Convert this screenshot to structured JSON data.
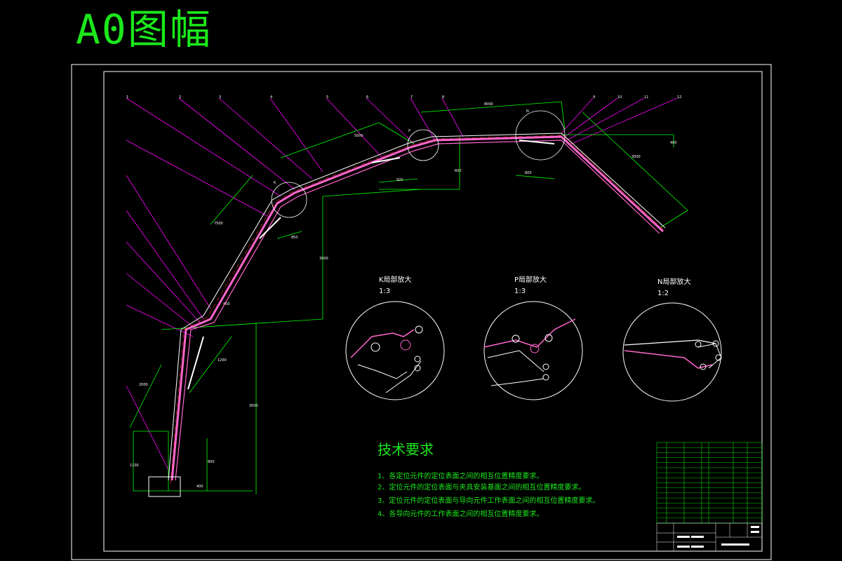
{
  "sheet": {
    "title": "A0图幅"
  },
  "callouts": [
    {
      "mark": "K",
      "caption": "K局部放大",
      "scale": "1:3"
    },
    {
      "mark": "P",
      "caption": "P局部放大",
      "scale": "1:3"
    },
    {
      "mark": "N",
      "caption": "N局部放大",
      "scale": "1:2"
    }
  ],
  "technical_requirements": {
    "heading": "技术要求",
    "items": [
      "1、各定位元件的定位表面之间的相互位置精度要求。",
      "2、定位元件的定位表面与夹具安装基面之间的相互位置精度要求。",
      "3、定位元件的定位表面与导向元件工作表面之间的相互位置精度要求。",
      "4、各导向元件的工作表面之间的相互位置精度要求。"
    ]
  },
  "colors": {
    "background": "#000000",
    "title_green": "#1be81b",
    "frame_white": "#ffffff",
    "dimension_green": "#00ff00",
    "leader_magenta": "#ff00ff",
    "body_pink": "#ff66cc",
    "centerline_red": "#ff3030"
  }
}
